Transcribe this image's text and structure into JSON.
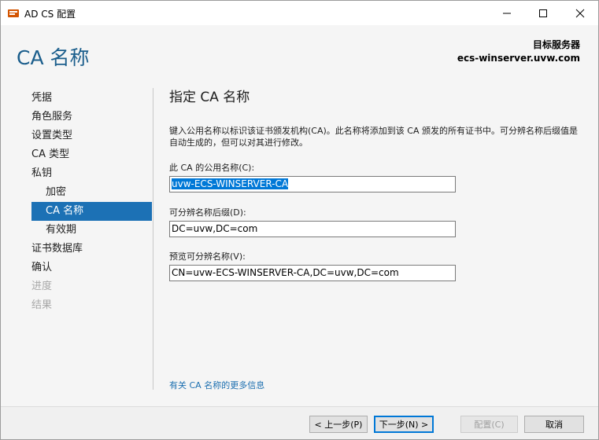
{
  "window": {
    "title": "AD CS 配置"
  },
  "header": {
    "page_title": "CA 名称",
    "target_label": "目标服务器",
    "target_value": "ecs-winserver.uvw.com"
  },
  "nav": {
    "items": [
      {
        "label": "凭据",
        "state": "normal"
      },
      {
        "label": "角色服务",
        "state": "normal"
      },
      {
        "label": "设置类型",
        "state": "normal"
      },
      {
        "label": "CA 类型",
        "state": "normal"
      },
      {
        "label": "私钥",
        "state": "normal"
      },
      {
        "label": "加密",
        "state": "sub"
      },
      {
        "label": "CA 名称",
        "state": "active"
      },
      {
        "label": "有效期",
        "state": "sub"
      },
      {
        "label": "证书数据库",
        "state": "normal"
      },
      {
        "label": "确认",
        "state": "normal"
      },
      {
        "label": "进度",
        "state": "disabled"
      },
      {
        "label": "结果",
        "state": "disabled"
      }
    ]
  },
  "content": {
    "title": "指定 CA 名称",
    "description": "键入公用名称以标识该证书颁发机构(CA)。此名称将添加到该 CA 颁发的所有证书中。可分辨名称后缀值是自动生成的，但可以对其进行修改。",
    "common_name_label": "此 CA 的公用名称(C):",
    "common_name_value": "uvw-ECS-WINSERVER-CA",
    "suffix_label": "可分辨名称后缀(D):",
    "suffix_value": "DC=uvw,DC=com",
    "preview_label": "预览可分辨名称(V):",
    "preview_value": "CN=uvw-ECS-WINSERVER-CA,DC=uvw,DC=com",
    "more_link": "有关 CA 名称的更多信息"
  },
  "footer": {
    "prev_label": "< 上一步(P)",
    "next_label": "下一步(N) >",
    "config_label": "配置(C)",
    "cancel_label": "取消"
  },
  "colors": {
    "accent": "#1c71b5",
    "title_blue": "#1b5e8c",
    "link": "#1c6fb0",
    "selection": "#0078d7"
  }
}
